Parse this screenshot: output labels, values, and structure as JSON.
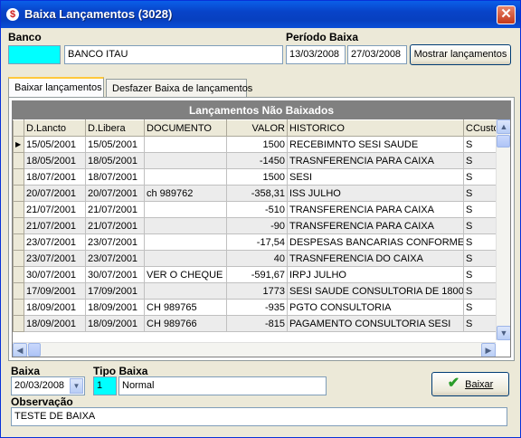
{
  "window": {
    "title": "Baixa Lançamentos (3028)",
    "close_glyph": "✕",
    "app_icon_glyph": "$",
    "app_icon": "dollar-icon"
  },
  "banco": {
    "label": "Banco",
    "code": "",
    "name": "BANCO ITAU"
  },
  "periodo": {
    "label": "Período Baixa",
    "start": "13/03/2008",
    "end": "27/03/2008",
    "show_button": "Mostrar lançamentos"
  },
  "tabs": [
    {
      "label": "Baixar lançamentos",
      "active": true
    },
    {
      "label": "Desfazer Baixa de lançamentos",
      "active": false
    }
  ],
  "grid": {
    "title": "Lançamentos Não Baixados",
    "columns": [
      "D.Lancto",
      "D.Libera",
      "DOCUMENTO",
      "VALOR",
      "HISTORICO",
      "CCusto"
    ],
    "rows": [
      {
        "d_lancto": "15/05/2001",
        "d_libera": "15/05/2001",
        "documento": "",
        "valor": "1500",
        "historico": "RECEBIMNTO SESI SAUDE",
        "ccusto": "S",
        "current": true
      },
      {
        "d_lancto": "18/05/2001",
        "d_libera": "18/05/2001",
        "documento": "",
        "valor": "-1450",
        "historico": "TRASNFERENCIA PARA CAIXA",
        "ccusto": "S"
      },
      {
        "d_lancto": "18/07/2001",
        "d_libera": "18/07/2001",
        "documento": "",
        "valor": "1500",
        "historico": "SESI",
        "ccusto": "S"
      },
      {
        "d_lancto": "20/07/2001",
        "d_libera": "20/07/2001",
        "documento": "ch 989762",
        "valor": "-358,31",
        "historico": "ISS JULHO",
        "ccusto": "S"
      },
      {
        "d_lancto": "21/07/2001",
        "d_libera": "21/07/2001",
        "documento": "",
        "valor": "-510",
        "historico": "TRANSFERENCIA PARA CAIXA",
        "ccusto": "S"
      },
      {
        "d_lancto": "21/07/2001",
        "d_libera": "21/07/2001",
        "documento": "",
        "valor": "-90",
        "historico": "TRANSFERENCIA PARA CAIXA",
        "ccusto": "S"
      },
      {
        "d_lancto": "23/07/2001",
        "d_libera": "23/07/2001",
        "documento": "",
        "valor": "-17,54",
        "historico": "DESPESAS BANCARIAS CONFORME E",
        "ccusto": "S"
      },
      {
        "d_lancto": "23/07/2001",
        "d_libera": "23/07/2001",
        "documento": "",
        "valor": "40",
        "historico": "TRASNFERENCIA DO CAIXA",
        "ccusto": "S"
      },
      {
        "d_lancto": "30/07/2001",
        "d_libera": "30/07/2001",
        "documento": "VER O CHEQUE",
        "valor": "-591,67",
        "historico": "IRPJ JULHO",
        "ccusto": "S"
      },
      {
        "d_lancto": "17/09/2001",
        "d_libera": "17/09/2001",
        "documento": "",
        "valor": "1773",
        "historico": "SESI SAUDE CONSULTORIA DE 1800",
        "ccusto": "S"
      },
      {
        "d_lancto": "18/09/2001",
        "d_libera": "18/09/2001",
        "documento": "CH 989765",
        "valor": "-935",
        "historico": "PGTO CONSULTORIA",
        "ccusto": "S"
      },
      {
        "d_lancto": "18/09/2001",
        "d_libera": "18/09/2001",
        "documento": "CH 989766",
        "valor": "-815",
        "historico": "PAGAMENTO CONSULTORIA SESI",
        "ccusto": "S"
      }
    ],
    "row_indicator": "▶",
    "scroll_up": "▲",
    "scroll_down": "▼",
    "scroll_left": "◀",
    "scroll_right": "▶"
  },
  "baixa": {
    "label": "Baixa",
    "date": "20/03/2008",
    "dropdown_glyph": "▼"
  },
  "tipo_baixa": {
    "label": "Tipo Baixa",
    "code": "1",
    "name": "Normal"
  },
  "baixar_button": {
    "label": "Baixar",
    "icon": "checkmark-icon",
    "glyph": "✔"
  },
  "observacao": {
    "label": "Observação",
    "value": "TESTE DE BAIXA"
  },
  "colors": {
    "title_bar": "#0843c8",
    "highlight_field": "#00ffff",
    "grid_header": "#808080"
  }
}
